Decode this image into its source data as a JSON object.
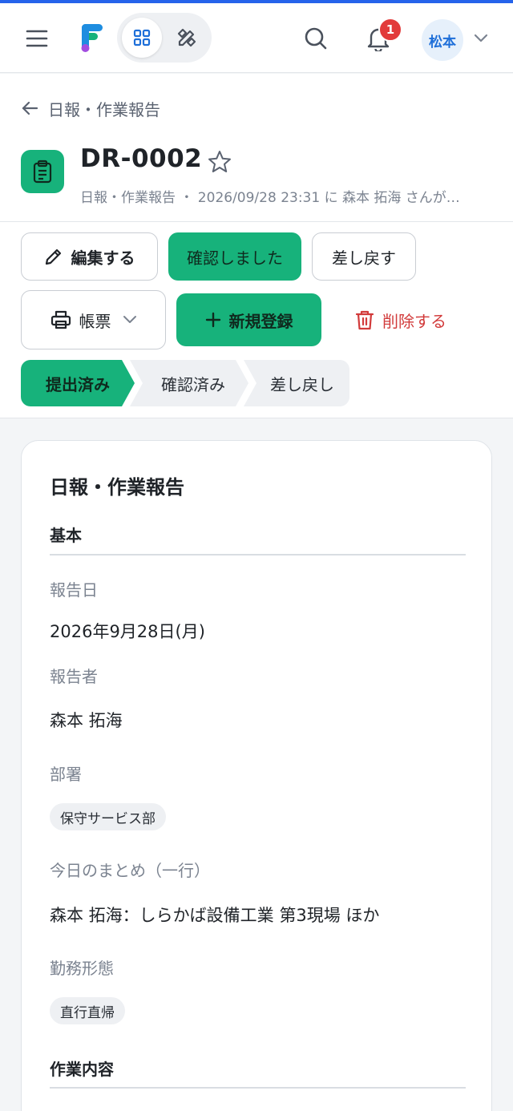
{
  "header": {
    "notification_count": "1",
    "user_initials": "松本"
  },
  "breadcrumb": {
    "back_label": "日報・作業報告"
  },
  "record": {
    "id": "DR-0002",
    "subtitle": "日報・作業報告 ・ 2026/09/28 23:31 に 森本 拓海 さんが…"
  },
  "actions": {
    "edit": "編集する",
    "confirm": "確認しました",
    "return": "差し戻す",
    "report": "帳票",
    "new": "新規登録",
    "delete": "削除する"
  },
  "status_steps": [
    "提出済み",
    "確認済み",
    "差し戻し"
  ],
  "colors": {
    "accent": "#17b27b",
    "brand_blue": "#2563eb",
    "danger": "#d23b3b"
  },
  "card": {
    "title": "日報・作業報告",
    "sections": {
      "basic": "基本",
      "work": "作業内容"
    },
    "fields": {
      "report_date_label": "報告日",
      "report_date_value": "2026年9月28日(月)",
      "reporter_label": "報告者",
      "reporter_value": "森本 拓海",
      "department_label": "部署",
      "department_value": "保守サービス部",
      "summary_label": "今日のまとめ（一行）",
      "summary_value": "森本 拓海：しらかば設備工業 第3現場 ほか",
      "work_style_label": "勤務形態",
      "work_style_value": "直行直帰"
    }
  }
}
